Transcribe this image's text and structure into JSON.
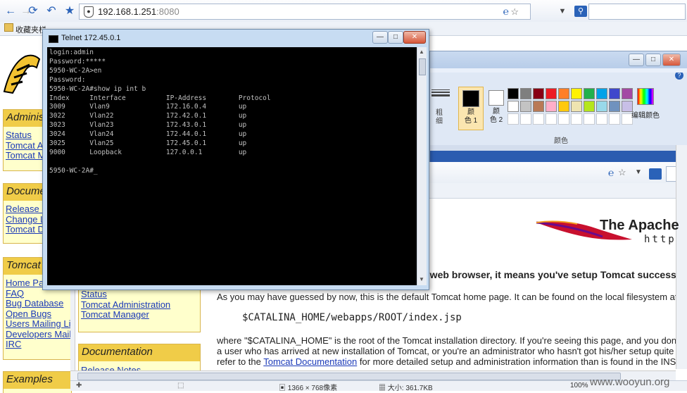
{
  "browser": {
    "address_host": "192.168.1.251",
    "address_port": ":8080",
    "favorites_label": "收藏夹栏"
  },
  "sidebar": {
    "admin": {
      "title": "Adminis",
      "links": [
        "Status",
        "Tomcat A",
        "Tomcat M"
      ]
    },
    "docs": {
      "title": "Docume",
      "links": [
        "Release N",
        "Change L",
        "Tomcat D"
      ]
    },
    "tomcat": {
      "title": "Tomcat",
      "links": [
        "Home Pa",
        "FAQ",
        "Bug Database",
        "Open Bugs",
        "Users Mailing Li",
        "Developers Mail",
        "IRC"
      ]
    },
    "examples": {
      "title": "Examples"
    }
  },
  "sidebar2": {
    "links": [
      "Status",
      "Tomcat Administration",
      "Tomcat Manager"
    ],
    "doc_title": "Documentation",
    "doc_link": "Release Notes"
  },
  "telnet": {
    "title": "Telnet 172.45.0.1",
    "lines": [
      "login:admin",
      "Password:*****",
      "5950-WC-2A>en",
      "Password:",
      "5950-WC-2A#show ip int b",
      "Index     Interface          IP-Address        Protocol",
      "3009      Vlan9              172.16.0.4        up",
      "3022      Vlan22             172.42.0.1        up",
      "3023      Vlan23             172.43.0.1        up",
      "3024      Vlan24             172.44.0.1        up",
      "3025      Vlan25             172.45.0.1        up",
      "9000      Loopback           127.0.0.1         up",
      "",
      "5950-WC-2A#_"
    ]
  },
  "paint": {
    "label_size1": "粗",
    "label_size2": "细",
    "color1_line1": "颜",
    "color1_line2": "色 1",
    "color2_line1": "颜",
    "color2_line2": "色 2",
    "edit_colors": "编辑颜色",
    "group_label": "颜色",
    "colors": [
      "#000000",
      "#7f7f7f",
      "#880015",
      "#ed1c24",
      "#ff7f27",
      "#fff200",
      "#22b14c",
      "#00a2e8",
      "#3f48cc",
      "#a349a4",
      "#ffffff",
      "#c3c3c3",
      "#b97a57",
      "#ffaec9",
      "#ffc90e",
      "#efe4b0",
      "#b5e61d",
      "#99d9ea",
      "#7092be",
      "#c8bfe7"
    ]
  },
  "page": {
    "apache_title": "The Apache",
    "apache_sub": "http",
    "heading": "a web browser, it means you've setup Tomcat successfull",
    "para1": "As you may have guessed by now, this is the default Tomcat home page. It can be found on the local filesystem at:",
    "path": "$CATALINA_HOME/webapps/ROOT/index.jsp",
    "para2a": "where \"$CATALINA_HOME\" is the root of the Tomcat installation directory. If you're seeing this page, and you don't th",
    "para2b": "a user who has arrived at new installation of Tomcat, or you're an administrator who hasn't got his/her setup quite right",
    "para2c_pre": "refer to the ",
    "para2c_link": "Tomcat Documentation",
    "para2c_post": " for more detailed setup and administration information than is found in the INSTAL"
  },
  "status_bar": {
    "dimensions": "1366 × 768像素",
    "size": "大小: 361.7KB",
    "zoom": "100%",
    "watermark": "www.wooyun.org"
  }
}
